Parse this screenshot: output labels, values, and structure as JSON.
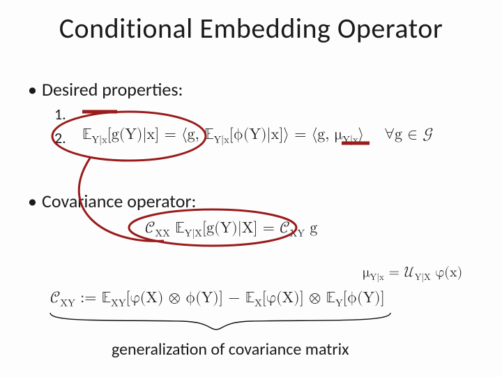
{
  "title": "Conditional Embedding Operator",
  "bullets": {
    "desired": "Desired properties:",
    "covariance": "Covariance operator:"
  },
  "numbers": {
    "one": "1.",
    "two": "2."
  },
  "equations": {
    "eq2": "𝔼_{Y|x}[g(Y)|x] = ⟨g, 𝔼_{Y|x}[ϕ(Y)|x]⟩ = ⟨g, μ_{Y|x}⟩   ∀g ∈ 𝒢",
    "cov_rel": "𝒞_{XX} 𝔼_{Y|X}[g(Y)|X] = 𝒞_{XY} g",
    "mu_def": "μ_{Y|x} = 𝒰_{Y|X} φ(x)",
    "cxy_def": "𝒞_{XY} := 𝔼_{XY}[φ(X) ⊗ ϕ(Y)] − 𝔼_X[φ(X)] ⊗ 𝔼_Y[ϕ(Y)]"
  },
  "caption": "generalization of covariance matrix"
}
